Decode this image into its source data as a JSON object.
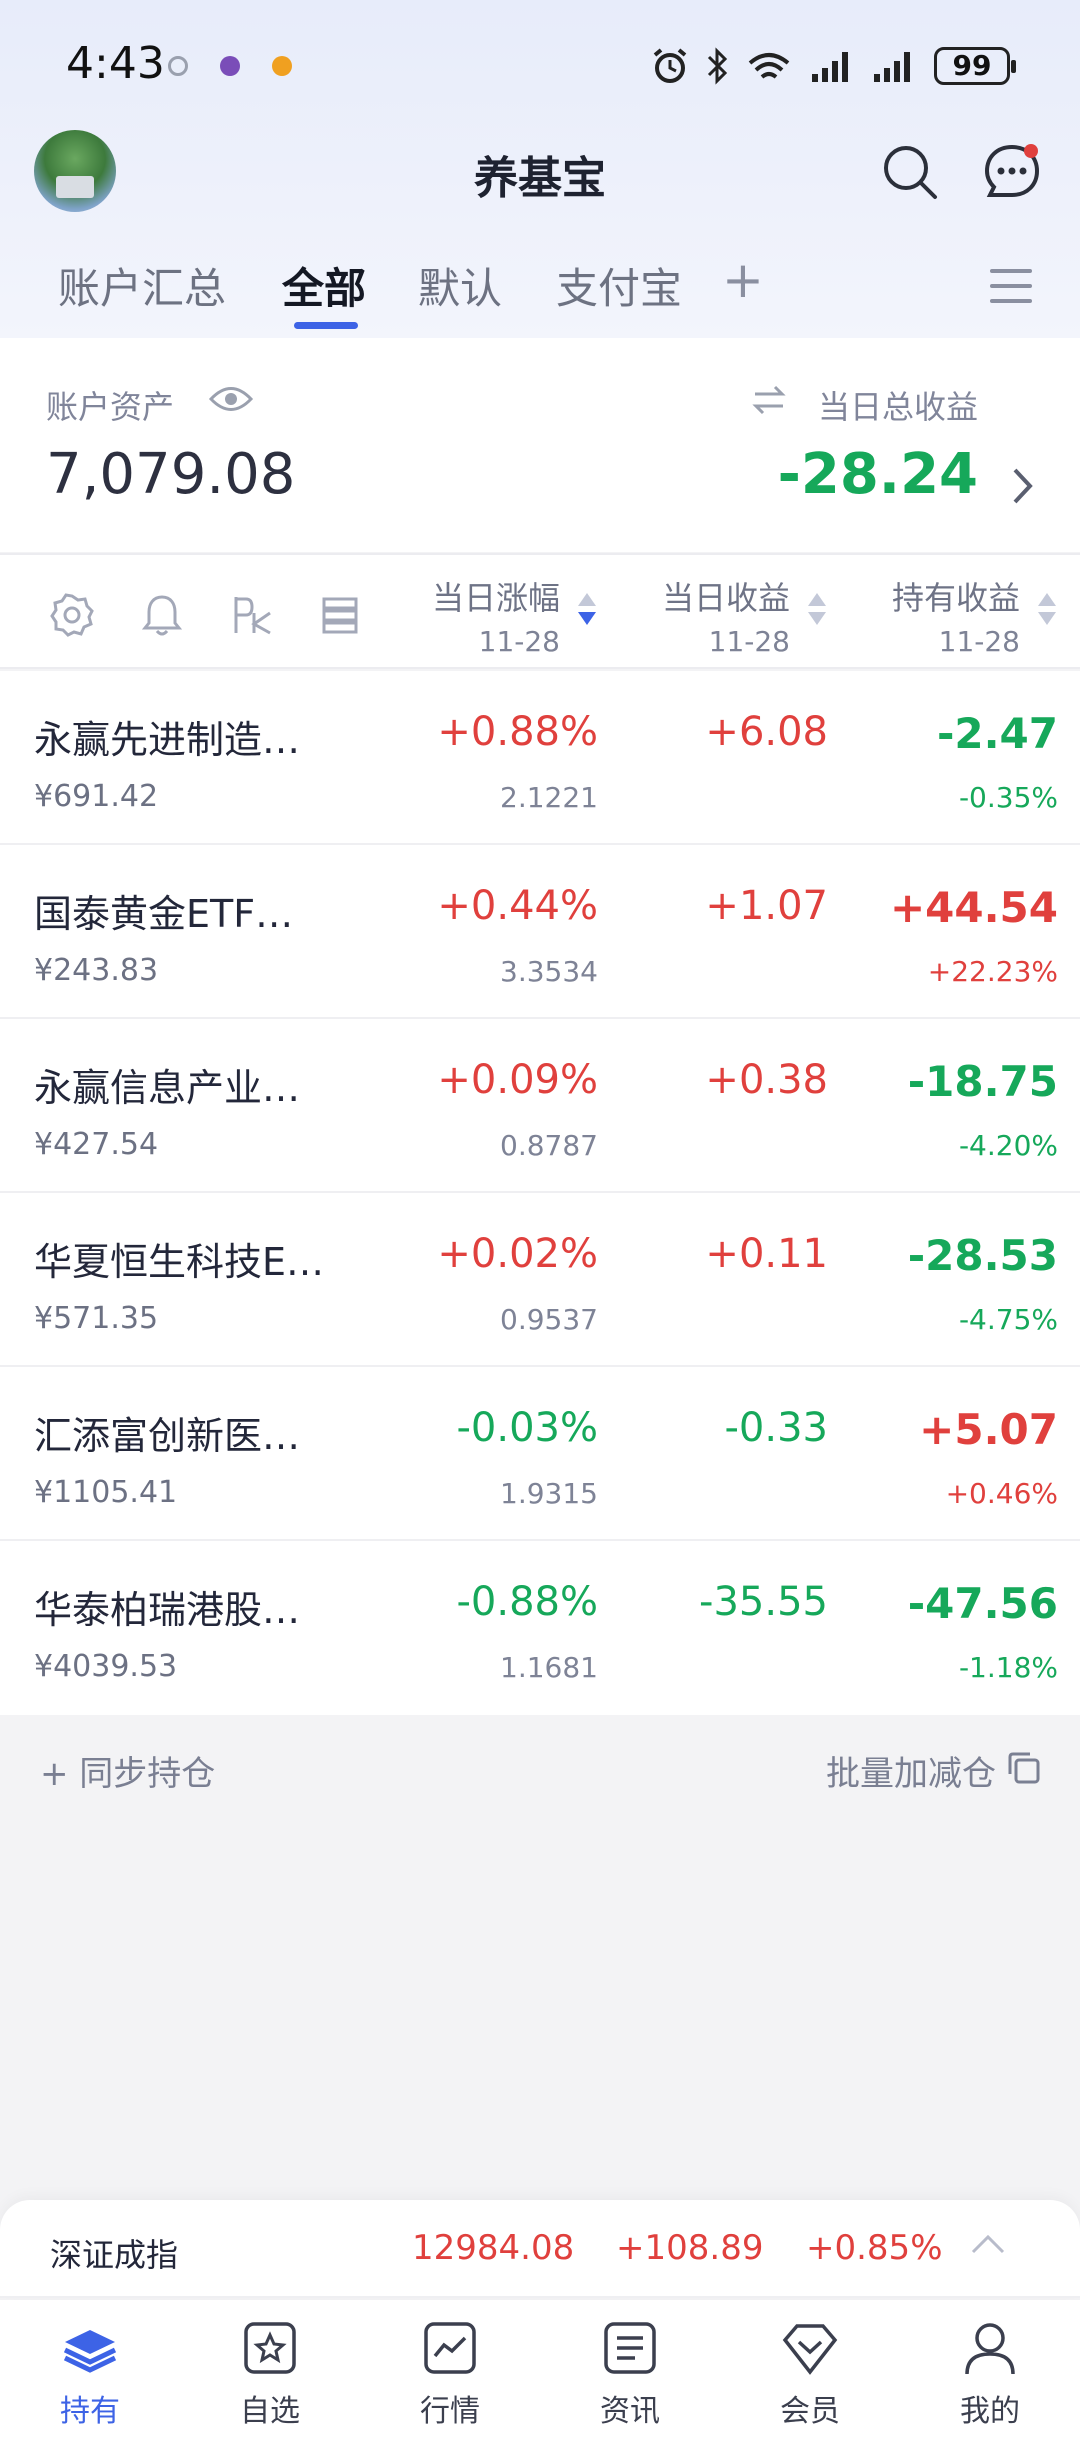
{
  "status_bar": {
    "time": "4:43",
    "battery": "99"
  },
  "header": {
    "title": "养基宝"
  },
  "tabs": [
    {
      "label": "账户汇总"
    },
    {
      "label": "全部"
    },
    {
      "label": "默认"
    },
    {
      "label": "支付宝"
    }
  ],
  "tab_add": "+",
  "account": {
    "assets_label": "账户资产",
    "assets_value": "7,079.08",
    "daily_income_label": "当日总收益",
    "daily_income_value": "-28.24"
  },
  "columns": [
    {
      "title": "当日涨幅",
      "date": "11-28"
    },
    {
      "title": "当日收益",
      "date": "11-28"
    },
    {
      "title": "持有收益",
      "date": "11-28"
    }
  ],
  "funds": [
    {
      "name": "永赢先进制造…",
      "amount": "¥691.42",
      "change": "+0.88%",
      "nav": "2.1221",
      "daily": "+6.08",
      "hold": "-2.47",
      "hold_pct": "-0.35%",
      "change_dir": "up",
      "daily_dir": "up",
      "hold_dir": "down"
    },
    {
      "name": "国泰黄金ETF…",
      "amount": "¥243.83",
      "change": "+0.44%",
      "nav": "3.3534",
      "daily": "+1.07",
      "hold": "+44.54",
      "hold_pct": "+22.23%",
      "change_dir": "up",
      "daily_dir": "up",
      "hold_dir": "up"
    },
    {
      "name": "永赢信息产业…",
      "amount": "¥427.54",
      "change": "+0.09%",
      "nav": "0.8787",
      "daily": "+0.38",
      "hold": "-18.75",
      "hold_pct": "-4.20%",
      "change_dir": "up",
      "daily_dir": "up",
      "hold_dir": "down"
    },
    {
      "name": "华夏恒生科技E…",
      "amount": "¥571.35",
      "change": "+0.02%",
      "nav": "0.9537",
      "daily": "+0.11",
      "hold": "-28.53",
      "hold_pct": "-4.75%",
      "change_dir": "up",
      "daily_dir": "up",
      "hold_dir": "down"
    },
    {
      "name": "汇添富创新医…",
      "amount": "¥1105.41",
      "change": "-0.03%",
      "nav": "1.9315",
      "daily": "-0.33",
      "hold": "+5.07",
      "hold_pct": "+0.46%",
      "change_dir": "down",
      "daily_dir": "down",
      "hold_dir": "up"
    },
    {
      "name": "华泰柏瑞港股…",
      "amount": "¥4039.53",
      "change": "-0.88%",
      "nav": "1.1681",
      "daily": "-35.55",
      "hold": "-47.56",
      "hold_pct": "-1.18%",
      "change_dir": "down",
      "daily_dir": "down",
      "hold_dir": "down"
    }
  ],
  "actions": {
    "sync": "+ 同步持仓",
    "batch": "批量加减仓"
  },
  "index_bar": {
    "name": "深证成指",
    "value": "12984.08",
    "change": "+108.89",
    "pct": "+0.85%"
  },
  "bottom_nav": [
    {
      "label": "持有",
      "icon": "holdings-icon"
    },
    {
      "label": "自选",
      "icon": "star-icon"
    },
    {
      "label": "行情",
      "icon": "chart-icon"
    },
    {
      "label": "资讯",
      "icon": "news-icon"
    },
    {
      "label": "会员",
      "icon": "vip-icon"
    },
    {
      "label": "我的",
      "icon": "user-icon"
    }
  ],
  "colors": {
    "accent": "#3d63e6",
    "up": "#e0403d",
    "down": "#16a85a"
  }
}
